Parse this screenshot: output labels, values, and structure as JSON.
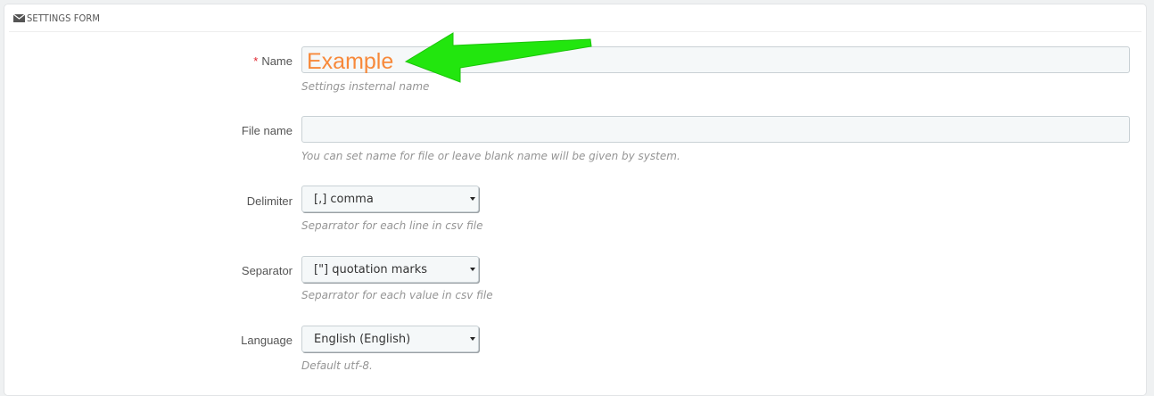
{
  "panel": {
    "title": "SETTINGS FORM",
    "icon": "envelope-icon"
  },
  "form": {
    "name": {
      "required_mark": "*",
      "label": "Name",
      "value": "Example",
      "help": "Settings insternal name"
    },
    "file_name": {
      "label": "File name",
      "value": "",
      "help": "You can set name for file or leave blank name will be given by system."
    },
    "delimiter": {
      "label": "Delimiter",
      "selected": "[,] comma",
      "help": "Separrator for each line in csv file"
    },
    "separator": {
      "label": "Separator",
      "selected": "[\"] quotation marks",
      "help": "Separrator for each value in csv file"
    },
    "language": {
      "label": "Language",
      "selected": "English (English)",
      "help": "Default utf-8."
    }
  },
  "colors": {
    "arrow": "#22e60e",
    "name_value": "#f7893a",
    "required": "#e0232d"
  }
}
